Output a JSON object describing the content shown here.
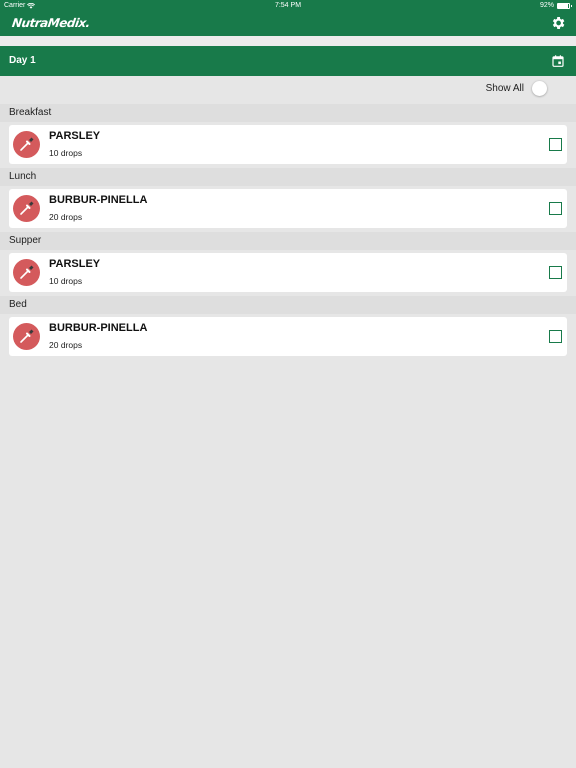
{
  "status_bar": {
    "carrier": "Carrier",
    "time": "7:54 PM",
    "battery_text": "92%",
    "battery_level": 0.92
  },
  "header": {
    "logo_text": "NutraMedix.",
    "settings_icon": "gear-icon",
    "brand_color": "#187a4a"
  },
  "day_bar": {
    "label": "Day 1",
    "calendar_icon": "calendar-icon"
  },
  "show_all": {
    "label": "Show All",
    "enabled": false
  },
  "sections": [
    {
      "title": "Breakfast",
      "item": {
        "name": "PARSLEY",
        "dose": "10 drops",
        "checked": false
      }
    },
    {
      "title": "Lunch",
      "item": {
        "name": "BURBUR-PINELLA",
        "dose": "20 drops",
        "checked": false
      }
    },
    {
      "title": "Supper",
      "item": {
        "name": "PARSLEY",
        "dose": "10 drops",
        "checked": false
      }
    },
    {
      "title": "Bed",
      "item": {
        "name": "BURBUR-PINELLA",
        "dose": "20 drops",
        "checked": false
      }
    }
  ],
  "item_icon": "dropper-icon",
  "accent_color": "#d45a5c"
}
